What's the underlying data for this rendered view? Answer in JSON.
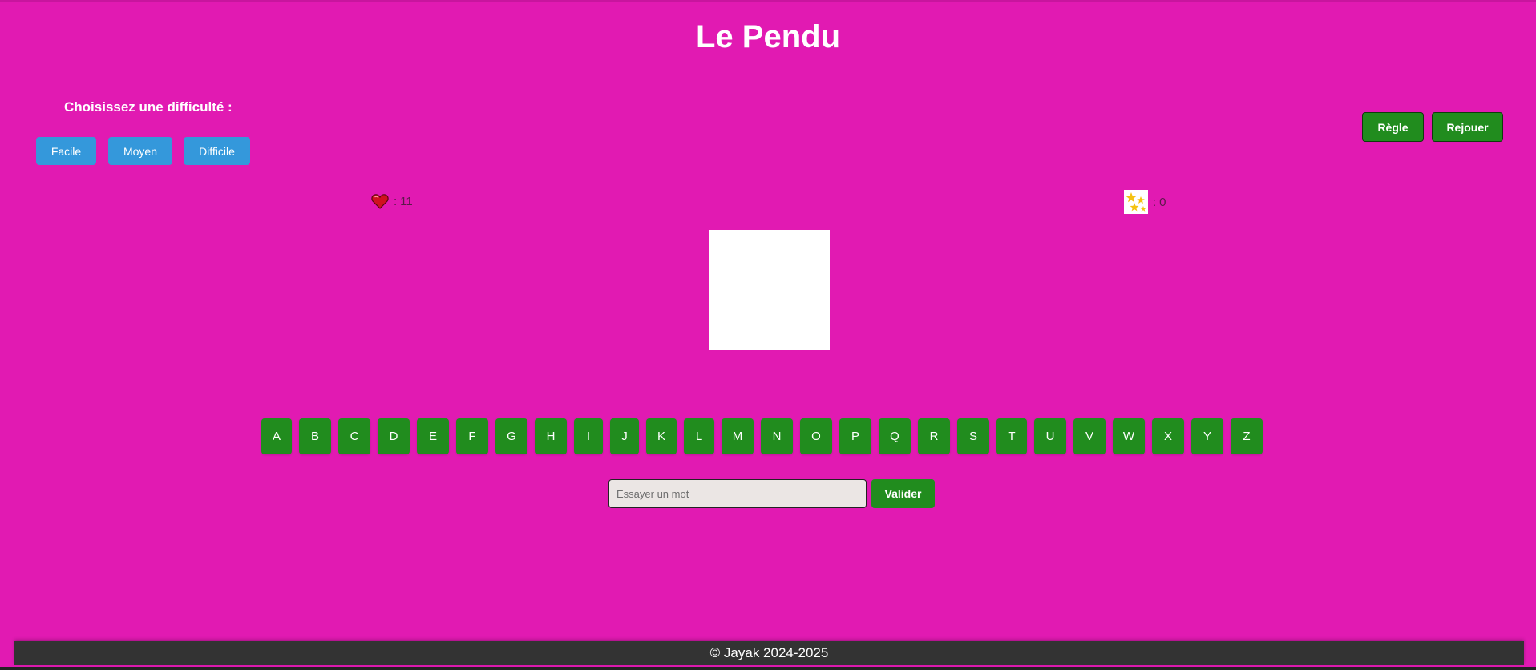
{
  "page": {
    "title": "Le Pendu",
    "background_color": "#e11ab2"
  },
  "difficulty": {
    "label": "Choisissez une difficulté :",
    "options": [
      "Facile",
      "Moyen",
      "Difficile"
    ],
    "button_color": "#3498db"
  },
  "actions": {
    "rules_label": "Règle",
    "replay_label": "Rejouer",
    "button_color": "#218c1e"
  },
  "stats": {
    "lives_icon": "heart-icon",
    "lives_separator": ":",
    "lives_value": "11",
    "score_icon": "stars-icon",
    "score_separator": ":",
    "score_value": "0"
  },
  "keyboard": {
    "letters": [
      "A",
      "B",
      "C",
      "D",
      "E",
      "F",
      "G",
      "H",
      "I",
      "J",
      "K",
      "L",
      "M",
      "N",
      "O",
      "P",
      "Q",
      "R",
      "S",
      "T",
      "U",
      "V",
      "W",
      "X",
      "Y",
      "Z"
    ]
  },
  "guess": {
    "placeholder": "Essayer un mot",
    "value": "",
    "submit_label": "Valider"
  },
  "footer": {
    "text": "© Jayak 2024-2025"
  }
}
